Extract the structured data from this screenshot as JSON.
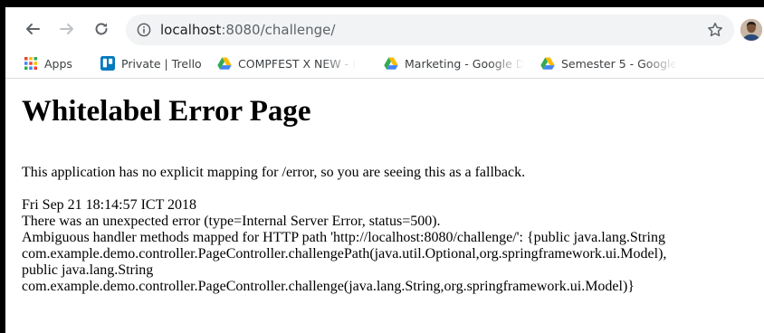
{
  "browser": {
    "url_host": "localhost",
    "url_rest": ":8080/challenge/",
    "bookmarks": [
      {
        "label": "Apps",
        "icon": "apps-grid-icon"
      },
      {
        "label": "Private | Trello",
        "icon": "trello-icon"
      },
      {
        "label": "COMPFEST X NEW - (",
        "icon": "google-drive-icon"
      },
      {
        "label": "Marketing - Google D",
        "icon": "google-drive-icon"
      },
      {
        "label": "Semester 5 - Google",
        "icon": "google-drive-icon"
      }
    ]
  },
  "page": {
    "heading": "Whitelabel Error Page",
    "message": "This application has no explicit mapping for /error, so you are seeing this as a fallback.",
    "timestamp": "Fri Sep 21 18:14:57 ICT 2018",
    "error_line": "There was an unexpected error (type=Internal Server Error, status=500).",
    "detail_lines": [
      "Ambiguous handler methods mapped for HTTP path 'http://localhost:8080/challenge/': {public java.lang.String",
      "com.example.demo.controller.PageController.challengePath(java.util.Optional,org.springframework.ui.Model),",
      "public java.lang.String",
      "com.example.demo.controller.PageController.challenge(java.lang.String,org.springframework.ui.Model)}"
    ]
  },
  "colors": {
    "trello": "#0079bf",
    "drive_yellow": "#fbbc04",
    "drive_green": "#34a853",
    "drive_blue": "#4285f4"
  }
}
